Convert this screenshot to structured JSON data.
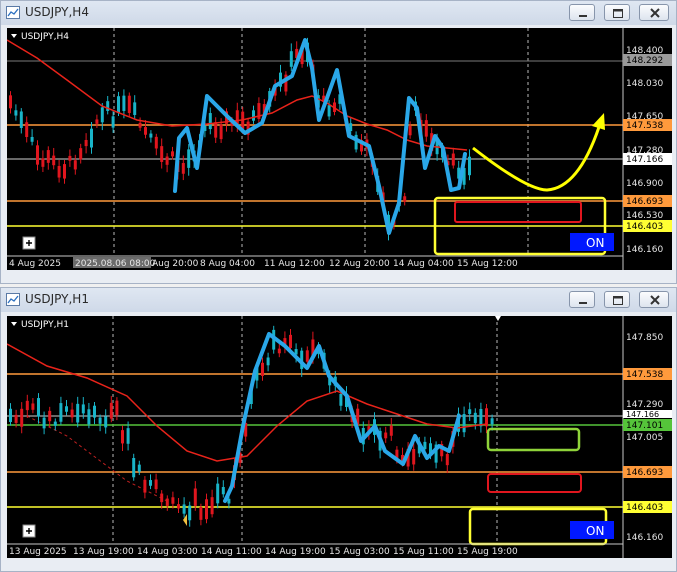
{
  "window_top": {
    "title": "USDJPY,H4",
    "chart_label": "USDJPY,H4",
    "price_labels": [
      "148.400",
      "148.292",
      "148.030",
      "147.650",
      "147.538",
      "147.280",
      "147.166",
      "146.900",
      "146.693",
      "146.530",
      "146.403",
      "146.160"
    ],
    "time_labels": [
      "4 Aug 2025",
      "2025.08.06 08:00",
      "Aug 20:00",
      "8 Aug 04:00",
      "11 Aug 12:00",
      "12 Aug 20:00",
      "14 Aug 04:00",
      "15 Aug 12:00"
    ],
    "on_label": "ON"
  },
  "window_bottom": {
    "title": "USDJPY,H1",
    "chart_label": "USDJPY,H1",
    "price_labels": [
      "147.850",
      "147.538",
      "147.290",
      "147.166",
      "147.101",
      "147.005",
      "146.693",
      "146.403",
      "146.160"
    ],
    "time_labels": [
      "13 Aug 2025",
      "13 Aug 19:00",
      "14 Aug 03:00",
      "14 Aug 11:00",
      "14 Aug 19:00",
      "15 Aug 03:00",
      "15 Aug 11:00",
      "15 Aug 19:00"
    ],
    "on_label": "ON"
  },
  "colors": {
    "candle_bull": "#19b4c8",
    "candle_bear": "#e0161e",
    "ma": "#e8231a",
    "orange_level": "#ff9a3c",
    "yellow_level": "#ffff33",
    "green_level": "#55c43a",
    "drawing_blue": "#2aa7e8",
    "arrow_yellow": "#ffff00",
    "on_bg": "#0018ff"
  }
}
